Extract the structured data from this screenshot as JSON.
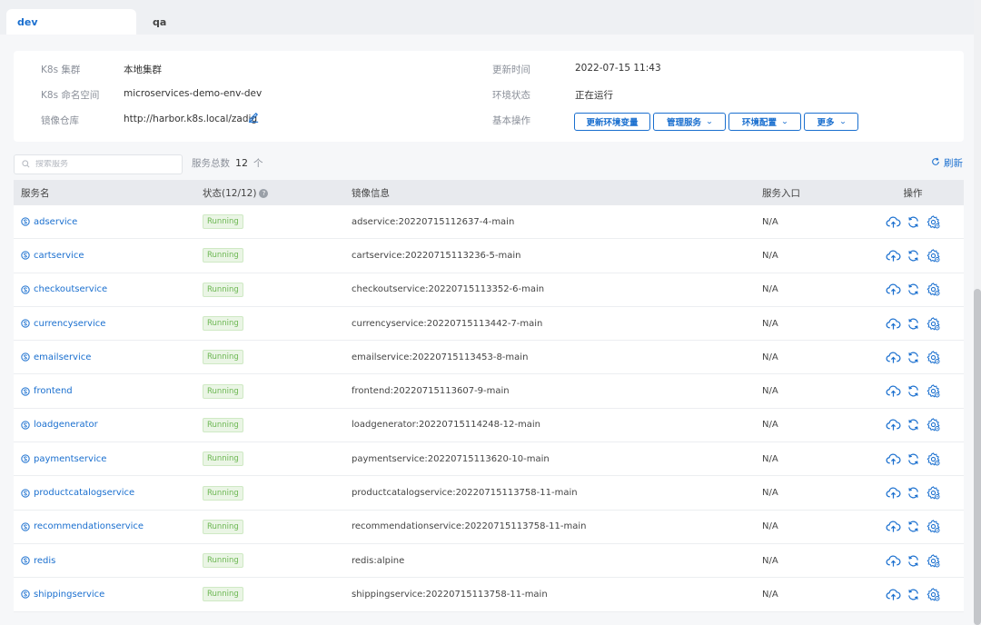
{
  "tabs": [
    {
      "label": "dev",
      "active": true
    },
    {
      "label": "qa",
      "active": false
    }
  ],
  "info": {
    "cluster_label": "K8s 集群",
    "cluster_value": "本地集群",
    "namespace_label": "K8s 命名空间",
    "namespace_value": "microservices-demo-env-dev",
    "registry_label": "镜像仓库",
    "registry_value": "http://harbor.k8s.local/zadig",
    "updated_label": "更新时间",
    "updated_value": "2022-07-15 11:43",
    "status_label": "环境状态",
    "status_value": "正在运行",
    "ops_label": "基本操作"
  },
  "ops_buttons": [
    {
      "label": "更新环境变量",
      "dropdown": false
    },
    {
      "label": "管理服务",
      "dropdown": true
    },
    {
      "label": "环境配置",
      "dropdown": true
    },
    {
      "label": "更多",
      "dropdown": true
    }
  ],
  "search": {
    "placeholder": "搜索服务"
  },
  "total": {
    "label": "服务总数",
    "count": "12",
    "unit": "个"
  },
  "refresh_label": "刷新",
  "table": {
    "headers": {
      "name": "服务名",
      "status": "状态(12/12)",
      "image": "镜像信息",
      "entry": "服务入口",
      "actions": "操作"
    },
    "rows": [
      {
        "name": "adservice",
        "status": "Running",
        "image": "adservice:20220715112637-4-main",
        "entry": "N/A"
      },
      {
        "name": "cartservice",
        "status": "Running",
        "image": "cartservice:20220715113236-5-main",
        "entry": "N/A"
      },
      {
        "name": "checkoutservice",
        "status": "Running",
        "image": "checkoutservice:20220715113352-6-main",
        "entry": "N/A"
      },
      {
        "name": "currencyservice",
        "status": "Running",
        "image": "currencyservice:20220715113442-7-main",
        "entry": "N/A"
      },
      {
        "name": "emailservice",
        "status": "Running",
        "image": "emailservice:20220715113453-8-main",
        "entry": "N/A"
      },
      {
        "name": "frontend",
        "status": "Running",
        "image": "frontend:20220715113607-9-main",
        "entry": "N/A"
      },
      {
        "name": "loadgenerator",
        "status": "Running",
        "image": "loadgenerator:20220715114248-12-main",
        "entry": "N/A"
      },
      {
        "name": "paymentservice",
        "status": "Running",
        "image": "paymentservice:20220715113620-10-main",
        "entry": "N/A"
      },
      {
        "name": "productcatalogservice",
        "status": "Running",
        "image": "productcatalogservice:20220715113758-11-main",
        "entry": "N/A"
      },
      {
        "name": "recommendationservice",
        "status": "Running",
        "image": "recommendationservice:20220715113758-11-main",
        "entry": "N/A"
      },
      {
        "name": "redis",
        "status": "Running",
        "image": "redis:alpine",
        "entry": "N/A"
      },
      {
        "name": "shippingservice",
        "status": "Running",
        "image": "shippingservice:20220715113758-11-main",
        "entry": "N/A"
      }
    ]
  },
  "colors": {
    "accent": "#1a6fcf",
    "running_text": "#6cb752",
    "running_bg": "#eaf5e5"
  },
  "icons": {
    "row_name": "service-icon",
    "actions": [
      "upload-cloud-icon",
      "restart-icon",
      "settings-gear-icon"
    ],
    "registry_edit": "edit-pencil-icon",
    "refresh": "refresh-icon",
    "search": "search-icon",
    "status_help": "help-icon"
  }
}
